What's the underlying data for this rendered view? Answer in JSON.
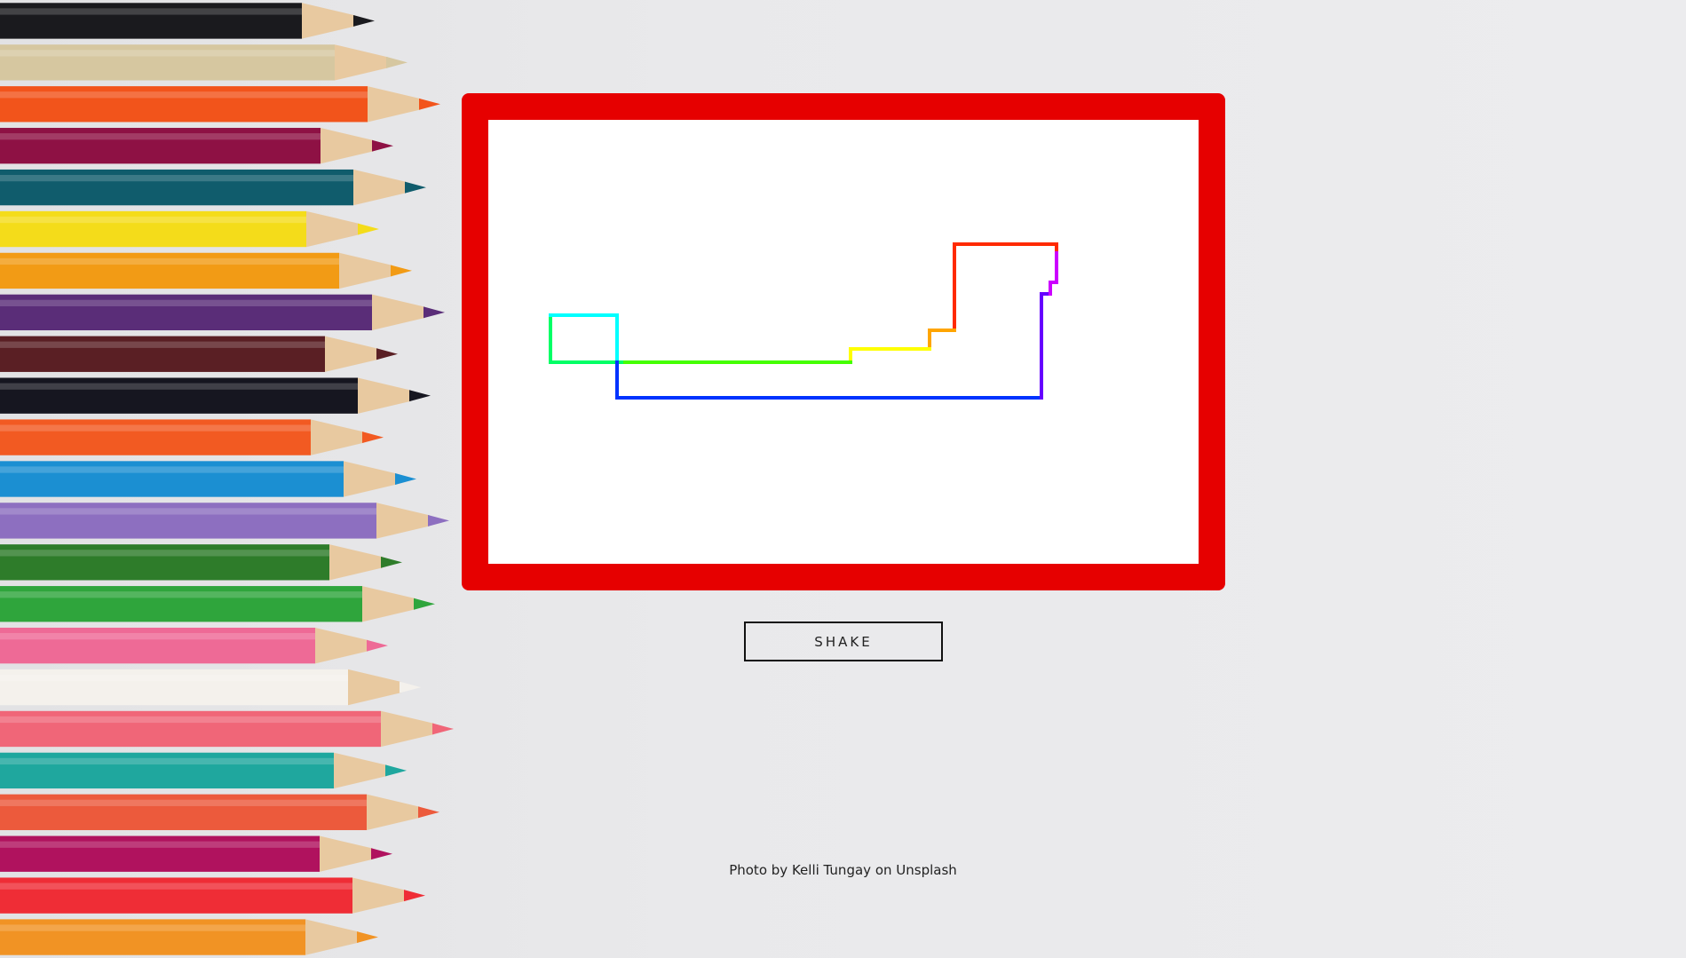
{
  "drawing": {
    "frame_color": "#e60000",
    "screen_color": "#ffffff",
    "line_gradient": [
      "#ff2a00",
      "#ffa500",
      "#ffff00",
      "#44ff00",
      "#00ff66",
      "#00ffff",
      "#0033ff",
      "#6600ff",
      "#cc00ff"
    ]
  },
  "controls": {
    "shake_label": "SHAKE"
  },
  "footer": {
    "prefix": "Photo by",
    "author": "Kelli Tungay",
    "middle": "on",
    "source": "Unsplash"
  },
  "pencils": {
    "colors": [
      "#1a1a1e",
      "#d6c7a0",
      "#f2541b",
      "#8e1144",
      "#105c6c",
      "#f4dc1a",
      "#f29b15",
      "#5a2d78",
      "#5a1f24",
      "#161620",
      "#f25a22",
      "#1b8fd2",
      "#8d6fc0",
      "#2e7c2a",
      "#2fa53c",
      "#ee6a96",
      "#f4f1ec",
      "#f06678",
      "#1fa79e",
      "#ec5a3c",
      "#b0125e",
      "#ef2d36",
      "#f19324"
    ]
  }
}
